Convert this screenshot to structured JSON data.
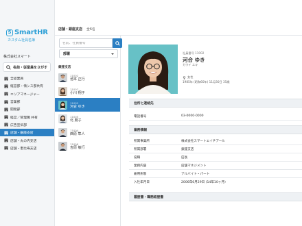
{
  "brand": {
    "logo_letter": "S",
    "name": "SmartHR",
    "subtitle": "カスタム社員名簿"
  },
  "sidebar": {
    "company": "株式会社スマート",
    "search_button": "名前・従業員をさがす",
    "items": [
      {
        "label": "全従業員",
        "active": false
      },
      {
        "label": "経営部・情シス部共有",
        "active": false
      },
      {
        "label": "エリアマネージャー",
        "active": false
      },
      {
        "label": "営業部",
        "active": false
      },
      {
        "label": "開発部",
        "active": false
      },
      {
        "label": "経営／管理職 共有",
        "active": false
      },
      {
        "label": "広告宣伝部",
        "active": false
      },
      {
        "label": "店舗・銀座支店",
        "active": true
      },
      {
        "label": "店舗・丸の内支店",
        "active": false
      },
      {
        "label": "店舗・恵比寿支店",
        "active": false
      }
    ]
  },
  "header": {
    "title": "店舗・銀座支店",
    "count": "全6名"
  },
  "list": {
    "search_placeholder": "名前、社員番号",
    "department_select": "部署",
    "group_label": "銀座支店",
    "members": [
      {
        "id": "11002",
        "name": "池本 正行",
        "active": false
      },
      {
        "id": "11007",
        "name": "小川 翔子",
        "active": false
      },
      {
        "id": "11002",
        "name": "河合 ゆき",
        "active": true
      },
      {
        "id": "11005",
        "name": "北 朋子",
        "active": false
      },
      {
        "id": "11004",
        "name": "西原 隼人",
        "active": false
      },
      {
        "id": "11006",
        "name": "吉原 敏行",
        "active": false
      }
    ]
  },
  "profile": {
    "employee_no": "社員番号 11002",
    "name": "河合 ゆき",
    "kana": "カワイ ユキ",
    "gender": "女性",
    "birthday": "1985年 (昭和60年) 11月30日 35歳"
  },
  "sections": {
    "address": {
      "title": "住所と連絡先",
      "rows": [
        {
          "key": "電話番号",
          "value": "03-0000-0000"
        }
      ]
    },
    "employment": {
      "title": "業務情報",
      "rows": [
        {
          "key": "所属事業所",
          "value": "株式会社スマートエイチアール"
        },
        {
          "key": "所属部署",
          "value": "銀座支店"
        },
        {
          "key": "役職",
          "value": "店長"
        },
        {
          "key": "業務内容",
          "value": "店舗マネジメント"
        },
        {
          "key": "雇用形態",
          "value": "アルバイト・パート"
        },
        {
          "key": "入社年月日",
          "value": "2006年6月29日 (14年10ヶ月)"
        }
      ]
    },
    "history": {
      "title": "履歴書・職務経歴書"
    }
  },
  "colors": {
    "accent": "#2b7fc3",
    "brand": "#2b9fd6",
    "photo_bg": "#67c1c6"
  }
}
